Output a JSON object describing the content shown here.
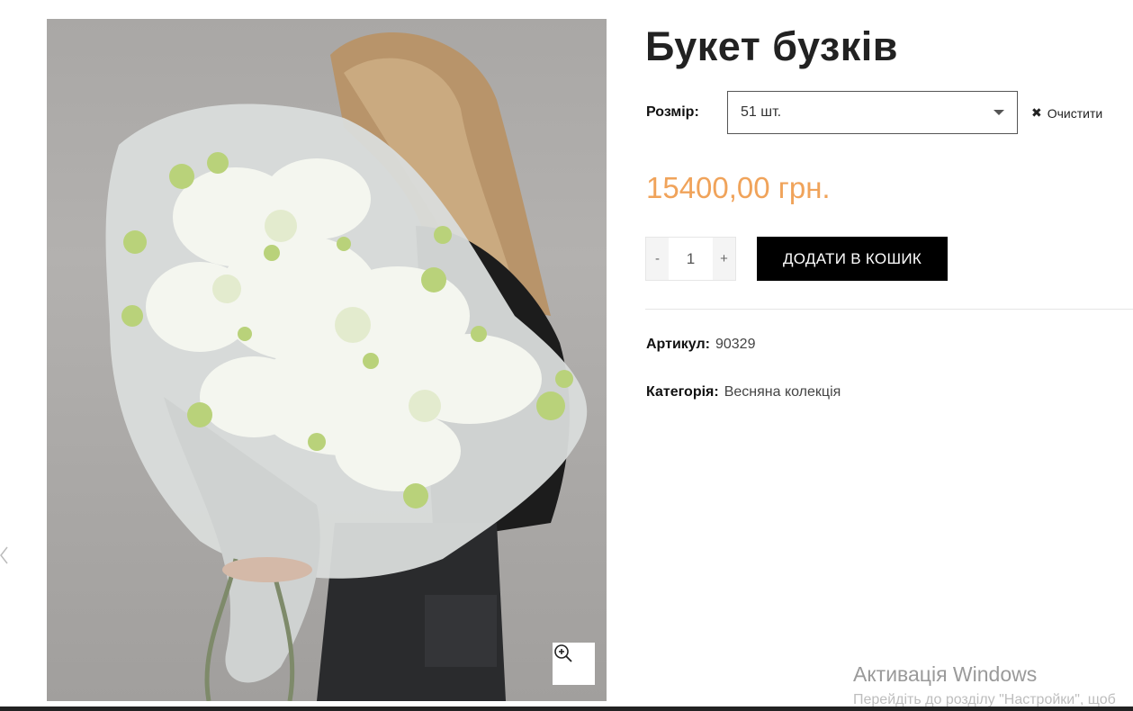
{
  "product": {
    "title": "Букет бузків",
    "size_label": "Розмір:",
    "size_selected": "51 шт.",
    "clear_label": "Очистити",
    "price": "15400,00 грн.",
    "quantity": "1",
    "qty_minus": "-",
    "qty_plus": "+",
    "add_to_cart_label": "ДОДАТИ В КОШИК",
    "sku_label": "Артикул:",
    "sku_value": "90329",
    "category_label": "Категорія:",
    "category_value": "Весняна колекція"
  },
  "gallery": {
    "zoom_icon": "zoom-in-icon"
  },
  "windows_watermark": {
    "title": "Активація Windows",
    "subtitle": "Перейдіть до розділу \"Настройки\", щоб"
  },
  "colors": {
    "price": "#f0a35a",
    "button_bg": "#000000",
    "button_text": "#ffffff"
  }
}
